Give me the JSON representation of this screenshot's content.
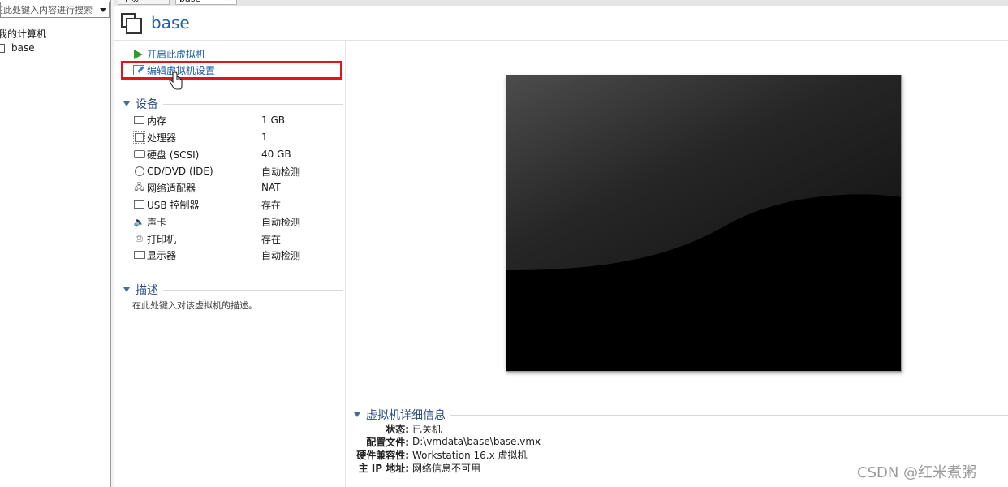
{
  "library": {
    "search_placeholder": "在此处键入内容进行搜索",
    "root_label": "我的计算机",
    "vm_label": "base"
  },
  "tabs": [
    {
      "label": "主页"
    },
    {
      "label": "base"
    }
  ],
  "header": {
    "title": "base"
  },
  "actions": {
    "power_on": "开启此虚拟机",
    "edit_settings": "编辑虚拟机设置"
  },
  "devices": {
    "title": "设备",
    "rows": [
      {
        "icon": "memory-icon",
        "name": "内存",
        "value": "1 GB"
      },
      {
        "icon": "processor-icon",
        "name": "处理器",
        "value": "1"
      },
      {
        "icon": "hard-disk-icon",
        "name": "硬盘 (SCSI)",
        "value": "40 GB"
      },
      {
        "icon": "cd-dvd-icon",
        "name": "CD/DVD (IDE)",
        "value": "自动检测"
      },
      {
        "icon": "network-adapter-icon",
        "name": "网络适配器",
        "value": "NAT"
      },
      {
        "icon": "usb-icon",
        "name": "USB 控制器",
        "value": "存在"
      },
      {
        "icon": "sound-card-icon",
        "name": "声卡",
        "value": "自动检测"
      },
      {
        "icon": "printer-icon",
        "name": "打印机",
        "value": "存在"
      },
      {
        "icon": "display-icon",
        "name": "显示器",
        "value": "自动检测"
      }
    ]
  },
  "description": {
    "title": "描述",
    "placeholder": "在此处键入对该虚拟机的描述。"
  },
  "details": {
    "title": "虚拟机详细信息",
    "rows": [
      {
        "label": "状态:",
        "value": "已关机"
      },
      {
        "label": "配置文件:",
        "value": "D:\\vmdata\\base\\base.vmx"
      },
      {
        "label": "硬件兼容性:",
        "value": "Workstation 16.x 虚拟机"
      },
      {
        "label": "主 IP 地址:",
        "value": "网络信息不可用"
      }
    ]
  },
  "watermark": "CSDN @红米煮粥",
  "colors": {
    "link": "#1e5fa8",
    "section": "#2c4f86",
    "highlight": "#e0141c",
    "play": "#2f9d2f"
  }
}
